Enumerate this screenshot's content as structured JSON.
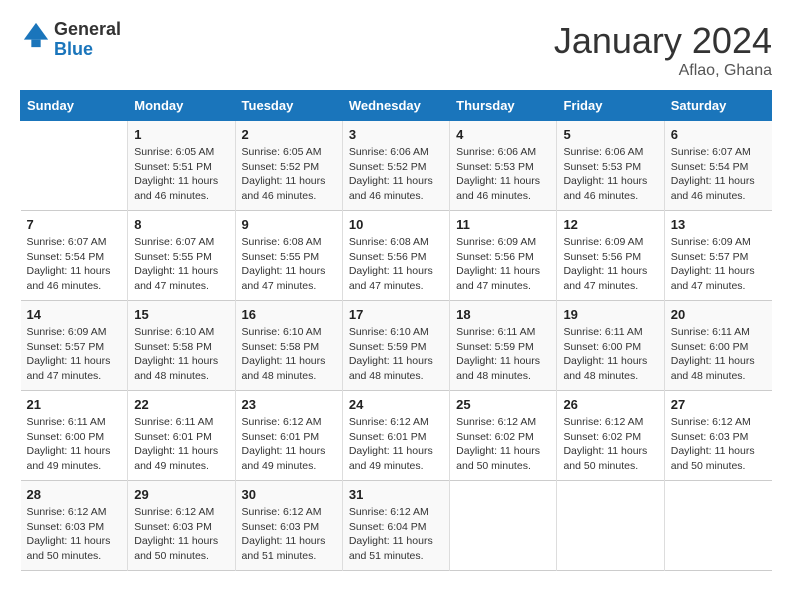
{
  "header": {
    "logo_line1": "General",
    "logo_line2": "Blue",
    "month": "January 2024",
    "location": "Aflao, Ghana"
  },
  "weekdays": [
    "Sunday",
    "Monday",
    "Tuesday",
    "Wednesday",
    "Thursday",
    "Friday",
    "Saturday"
  ],
  "weeks": [
    [
      {
        "day": "",
        "sunrise": "",
        "sunset": "",
        "daylight": ""
      },
      {
        "day": "1",
        "sunrise": "6:05 AM",
        "sunset": "5:51 PM",
        "daylight": "11 hours and 46 minutes."
      },
      {
        "day": "2",
        "sunrise": "6:05 AM",
        "sunset": "5:52 PM",
        "daylight": "11 hours and 46 minutes."
      },
      {
        "day": "3",
        "sunrise": "6:06 AM",
        "sunset": "5:52 PM",
        "daylight": "11 hours and 46 minutes."
      },
      {
        "day": "4",
        "sunrise": "6:06 AM",
        "sunset": "5:53 PM",
        "daylight": "11 hours and 46 minutes."
      },
      {
        "day": "5",
        "sunrise": "6:06 AM",
        "sunset": "5:53 PM",
        "daylight": "11 hours and 46 minutes."
      },
      {
        "day": "6",
        "sunrise": "6:07 AM",
        "sunset": "5:54 PM",
        "daylight": "11 hours and 46 minutes."
      }
    ],
    [
      {
        "day": "7",
        "sunrise": "6:07 AM",
        "sunset": "5:54 PM",
        "daylight": "11 hours and 46 minutes."
      },
      {
        "day": "8",
        "sunrise": "6:07 AM",
        "sunset": "5:55 PM",
        "daylight": "11 hours and 47 minutes."
      },
      {
        "day": "9",
        "sunrise": "6:08 AM",
        "sunset": "5:55 PM",
        "daylight": "11 hours and 47 minutes."
      },
      {
        "day": "10",
        "sunrise": "6:08 AM",
        "sunset": "5:56 PM",
        "daylight": "11 hours and 47 minutes."
      },
      {
        "day": "11",
        "sunrise": "6:09 AM",
        "sunset": "5:56 PM",
        "daylight": "11 hours and 47 minutes."
      },
      {
        "day": "12",
        "sunrise": "6:09 AM",
        "sunset": "5:56 PM",
        "daylight": "11 hours and 47 minutes."
      },
      {
        "day": "13",
        "sunrise": "6:09 AM",
        "sunset": "5:57 PM",
        "daylight": "11 hours and 47 minutes."
      }
    ],
    [
      {
        "day": "14",
        "sunrise": "6:09 AM",
        "sunset": "5:57 PM",
        "daylight": "11 hours and 47 minutes."
      },
      {
        "day": "15",
        "sunrise": "6:10 AM",
        "sunset": "5:58 PM",
        "daylight": "11 hours and 48 minutes."
      },
      {
        "day": "16",
        "sunrise": "6:10 AM",
        "sunset": "5:58 PM",
        "daylight": "11 hours and 48 minutes."
      },
      {
        "day": "17",
        "sunrise": "6:10 AM",
        "sunset": "5:59 PM",
        "daylight": "11 hours and 48 minutes."
      },
      {
        "day": "18",
        "sunrise": "6:11 AM",
        "sunset": "5:59 PM",
        "daylight": "11 hours and 48 minutes."
      },
      {
        "day": "19",
        "sunrise": "6:11 AM",
        "sunset": "6:00 PM",
        "daylight": "11 hours and 48 minutes."
      },
      {
        "day": "20",
        "sunrise": "6:11 AM",
        "sunset": "6:00 PM",
        "daylight": "11 hours and 48 minutes."
      }
    ],
    [
      {
        "day": "21",
        "sunrise": "6:11 AM",
        "sunset": "6:00 PM",
        "daylight": "11 hours and 49 minutes."
      },
      {
        "day": "22",
        "sunrise": "6:11 AM",
        "sunset": "6:01 PM",
        "daylight": "11 hours and 49 minutes."
      },
      {
        "day": "23",
        "sunrise": "6:12 AM",
        "sunset": "6:01 PM",
        "daylight": "11 hours and 49 minutes."
      },
      {
        "day": "24",
        "sunrise": "6:12 AM",
        "sunset": "6:01 PM",
        "daylight": "11 hours and 49 minutes."
      },
      {
        "day": "25",
        "sunrise": "6:12 AM",
        "sunset": "6:02 PM",
        "daylight": "11 hours and 50 minutes."
      },
      {
        "day": "26",
        "sunrise": "6:12 AM",
        "sunset": "6:02 PM",
        "daylight": "11 hours and 50 minutes."
      },
      {
        "day": "27",
        "sunrise": "6:12 AM",
        "sunset": "6:03 PM",
        "daylight": "11 hours and 50 minutes."
      }
    ],
    [
      {
        "day": "28",
        "sunrise": "6:12 AM",
        "sunset": "6:03 PM",
        "daylight": "11 hours and 50 minutes."
      },
      {
        "day": "29",
        "sunrise": "6:12 AM",
        "sunset": "6:03 PM",
        "daylight": "11 hours and 50 minutes."
      },
      {
        "day": "30",
        "sunrise": "6:12 AM",
        "sunset": "6:03 PM",
        "daylight": "11 hours and 51 minutes."
      },
      {
        "day": "31",
        "sunrise": "6:12 AM",
        "sunset": "6:04 PM",
        "daylight": "11 hours and 51 minutes."
      },
      {
        "day": "",
        "sunrise": "",
        "sunset": "",
        "daylight": ""
      },
      {
        "day": "",
        "sunrise": "",
        "sunset": "",
        "daylight": ""
      },
      {
        "day": "",
        "sunrise": "",
        "sunset": "",
        "daylight": ""
      }
    ]
  ]
}
